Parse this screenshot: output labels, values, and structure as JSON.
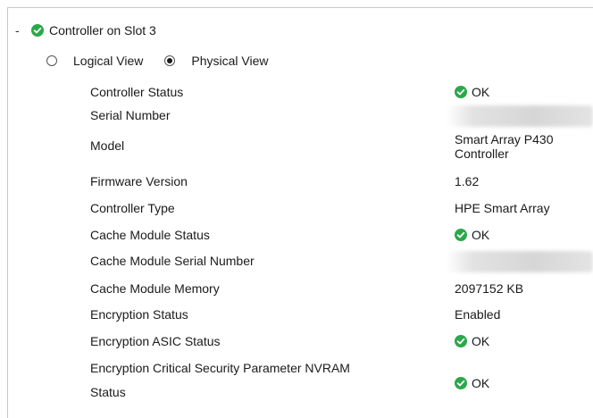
{
  "controller": {
    "title": "Controller on Slot 3",
    "collapse_symbol": "-",
    "status_icon": "check-circle-icon",
    "accent_color": "#2aa84a"
  },
  "view_toggle": {
    "logical_label": "Logical View",
    "physical_label": "Physical View",
    "selected": "Physical View"
  },
  "properties": {
    "controller_status": {
      "label": "Controller Status",
      "value": "OK"
    },
    "serial_number": {
      "label": "Serial Number",
      "value": ""
    },
    "model": {
      "label": "Model",
      "value_line1": "Smart Array P430",
      "value_line2": "Controller"
    },
    "firmware_version": {
      "label": "Firmware Version",
      "value": "1.62"
    },
    "controller_type": {
      "label": "Controller Type",
      "value": "HPE Smart Array"
    },
    "cache_module_status": {
      "label": "Cache Module Status",
      "value": "OK"
    },
    "cache_module_serial": {
      "label": "Cache Module Serial Number",
      "value": ""
    },
    "cache_module_memory": {
      "label": "Cache Module Memory",
      "value": "2097152 KB"
    },
    "encryption_status": {
      "label": "Encryption Status",
      "value": "Enabled"
    },
    "encryption_asic_status": {
      "label": "Encryption ASIC Status",
      "value": "OK"
    },
    "encryption_csp_nvram_status": {
      "label_line1": "Encryption Critical Security Parameter NVRAM",
      "label_line2": "Status",
      "value": "OK"
    }
  }
}
